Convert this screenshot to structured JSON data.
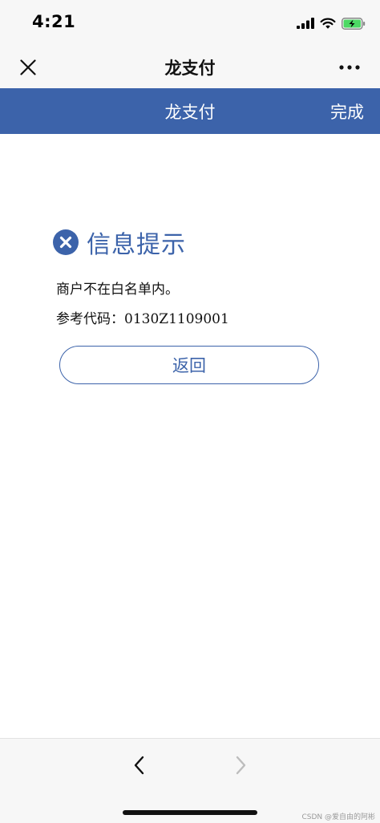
{
  "status_bar": {
    "time": "4:21"
  },
  "nav_bar": {
    "title": "龙支付"
  },
  "header": {
    "title": "龙支付",
    "done_label": "完成",
    "background_color": "#3c63aa"
  },
  "content": {
    "info_title": "信息提示",
    "message": "商户不在白名单内。",
    "code_label": "参考代码：",
    "code_value": "0130Z1109001",
    "back_button_label": "返回"
  },
  "icons": {
    "close": "close-icon",
    "more": "more-icon",
    "error": "error-circle-icon",
    "back": "chevron-left-icon",
    "forward": "chevron-right-icon"
  },
  "watermark": "CSDN @爱自由的阿彬"
}
